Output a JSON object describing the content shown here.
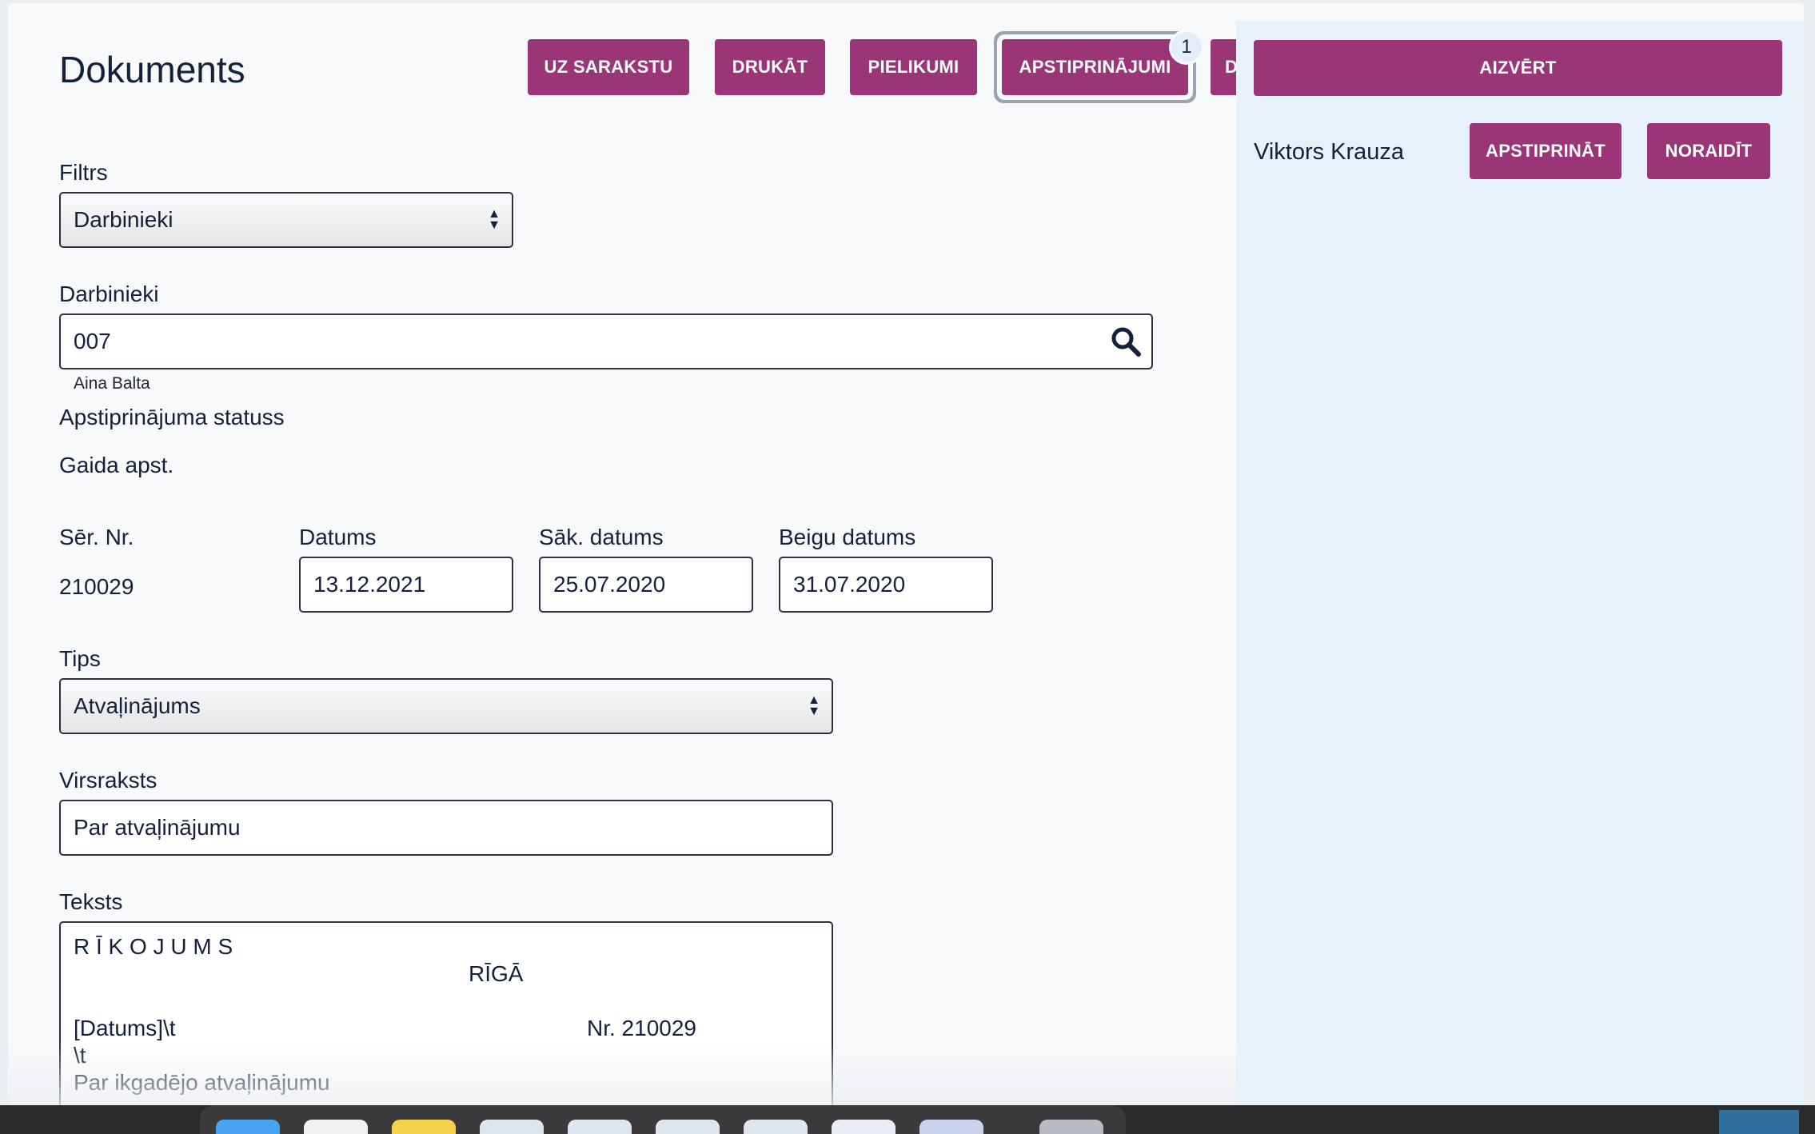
{
  "page": {
    "title": "Dokuments"
  },
  "toolbar": {
    "buttons": [
      {
        "label": "UZ SARAKSTU"
      },
      {
        "label": "DRUKĀT"
      },
      {
        "label": "PIELIKUMI"
      },
      {
        "label": "APSTIPRINĀJUMI",
        "badge": "1"
      },
      {
        "label": "D"
      }
    ]
  },
  "form": {
    "filter": {
      "label": "Filtrs",
      "value": "Darbinieki"
    },
    "employee": {
      "label": "Darbinieki",
      "value": "007",
      "hint": "Aina Balta"
    },
    "status": {
      "label": "Apstiprinājuma statuss",
      "value": "Gaida apst."
    },
    "serial": {
      "label": "Sēr. Nr.",
      "value": "210029"
    },
    "date": {
      "label": "Datums",
      "value": "13.12.2021"
    },
    "start_date": {
      "label": "Sāk. datums",
      "value": "25.07.2020"
    },
    "end_date": {
      "label": "Beigu datums",
      "value": "31.07.2020"
    },
    "type": {
      "label": "Tips",
      "value": "Atvaļinājums"
    },
    "heading": {
      "label": "Virsraksts",
      "value": "Par atvaļinājumu"
    },
    "text": {
      "label": "Teksts",
      "line1": "R Ī K O J U M S",
      "line2": "RĪGĀ",
      "line3a": "[Datums]\\t",
      "line3b": "Nr. 210029",
      "line4": "\\t",
      "line5": "Par ikgadējo atvaļinājumu"
    }
  },
  "approval_panel": {
    "close_label": "AIZVĒRT",
    "approver": "Viktors Krauza",
    "approve_label": "APSTIPRINĀT",
    "reject_label": "NORAIDĪT"
  },
  "colors": {
    "accent": "#9a3578",
    "panel": "#e7f1fa",
    "text": "#14213a"
  }
}
